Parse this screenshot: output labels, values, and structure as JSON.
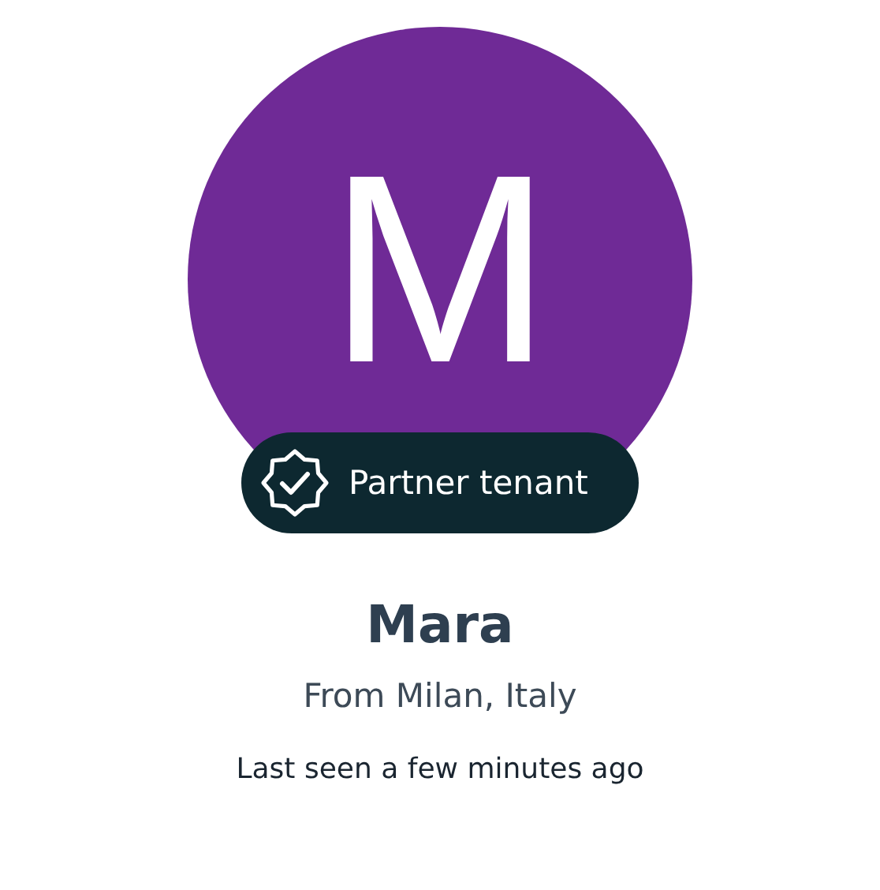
{
  "avatar": {
    "initial": "M"
  },
  "badge": {
    "label": "Partner tenant"
  },
  "name": "Mara",
  "location": "From Milan, Italy",
  "last_seen": "Last seen a few minutes ago"
}
